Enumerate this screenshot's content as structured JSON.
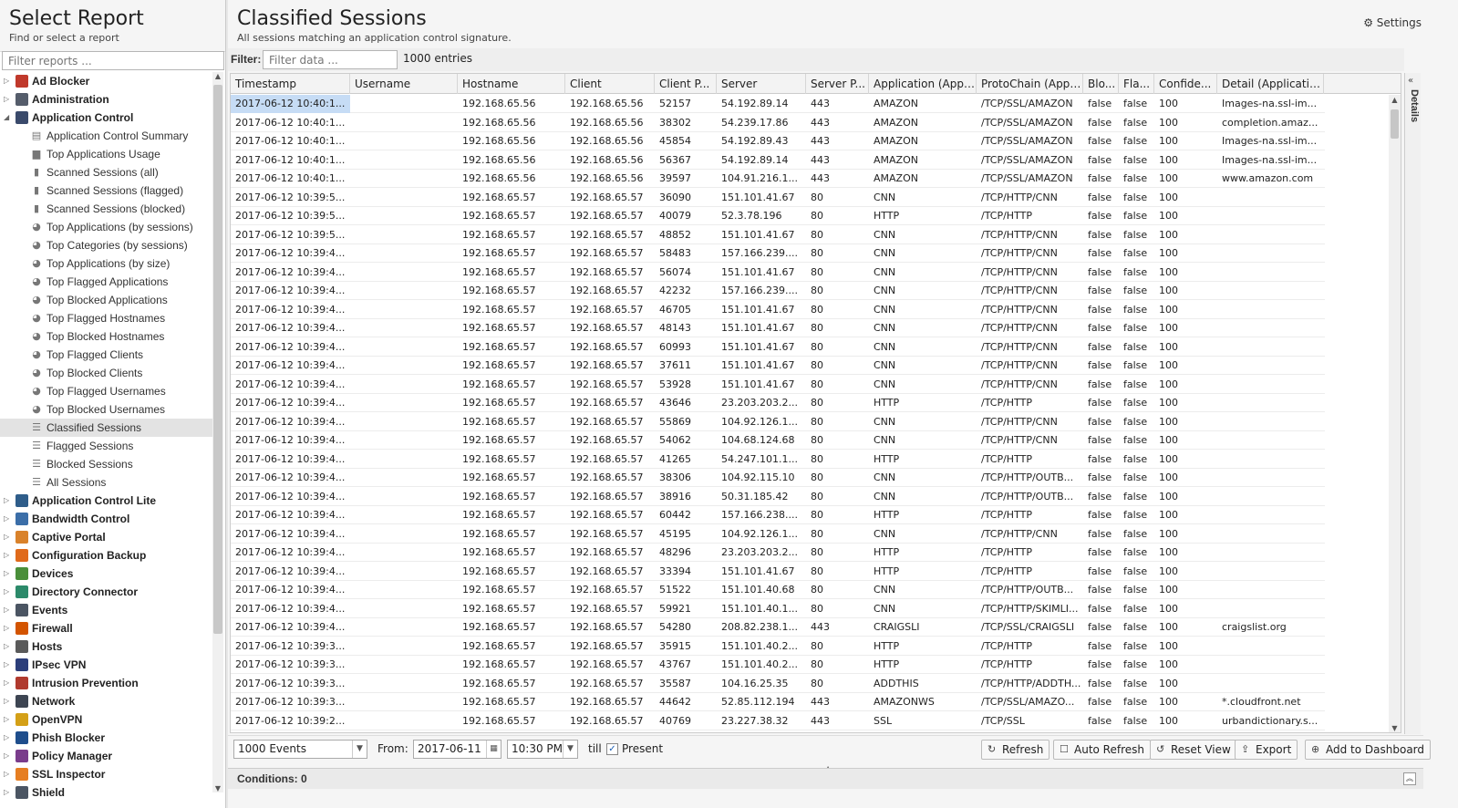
{
  "left": {
    "title": "Select Report",
    "subtitle": "Find or select a report",
    "filter_placeholder": "Filter reports ..."
  },
  "tree": [
    {
      "label": "Ad Blocker",
      "type": "app",
      "color": "#c0392b",
      "expanded": false
    },
    {
      "label": "Administration",
      "type": "app",
      "color": "#555d6b",
      "expanded": false
    },
    {
      "label": "Application Control",
      "type": "app",
      "color": "#3a4a6b",
      "expanded": true
    },
    {
      "label": "Application Control Summary",
      "type": "child",
      "icon": "doc"
    },
    {
      "label": "Top Applications Usage",
      "type": "child",
      "icon": "area"
    },
    {
      "label": "Scanned Sessions (all)",
      "type": "child",
      "icon": "bar"
    },
    {
      "label": "Scanned Sessions (flagged)",
      "type": "child",
      "icon": "bar"
    },
    {
      "label": "Scanned Sessions (blocked)",
      "type": "child",
      "icon": "bar"
    },
    {
      "label": "Top Applications (by sessions)",
      "type": "child",
      "icon": "pie"
    },
    {
      "label": "Top Categories (by sessions)",
      "type": "child",
      "icon": "pie"
    },
    {
      "label": "Top Applications (by size)",
      "type": "child",
      "icon": "pie"
    },
    {
      "label": "Top Flagged Applications",
      "type": "child",
      "icon": "pie"
    },
    {
      "label": "Top Blocked Applications",
      "type": "child",
      "icon": "pie"
    },
    {
      "label": "Top Flagged Hostnames",
      "type": "child",
      "icon": "pie"
    },
    {
      "label": "Top Blocked Hostnames",
      "type": "child",
      "icon": "pie"
    },
    {
      "label": "Top Flagged Clients",
      "type": "child",
      "icon": "pie"
    },
    {
      "label": "Top Blocked Clients",
      "type": "child",
      "icon": "pie"
    },
    {
      "label": "Top Flagged Usernames",
      "type": "child",
      "icon": "pie"
    },
    {
      "label": "Top Blocked Usernames",
      "type": "child",
      "icon": "pie"
    },
    {
      "label": "Classified Sessions",
      "type": "child",
      "icon": "list",
      "selected": true
    },
    {
      "label": "Flagged Sessions",
      "type": "child",
      "icon": "list"
    },
    {
      "label": "Blocked Sessions",
      "type": "child",
      "icon": "list"
    },
    {
      "label": "All Sessions",
      "type": "child",
      "icon": "list"
    },
    {
      "label": "Application Control Lite",
      "type": "app",
      "color": "#2f5d8a",
      "expanded": false
    },
    {
      "label": "Bandwidth Control",
      "type": "app",
      "color": "#3b6ea8",
      "expanded": false
    },
    {
      "label": "Captive Portal",
      "type": "app",
      "color": "#d9822b",
      "expanded": false
    },
    {
      "label": "Configuration Backup",
      "type": "app",
      "color": "#e06a1b",
      "expanded": false
    },
    {
      "label": "Devices",
      "type": "app",
      "color": "#4a8f3a",
      "expanded": false
    },
    {
      "label": "Directory Connector",
      "type": "app",
      "color": "#2c8a6a",
      "expanded": false
    },
    {
      "label": "Events",
      "type": "app",
      "color": "#4b5563",
      "expanded": false
    },
    {
      "label": "Firewall",
      "type": "app",
      "color": "#d35400",
      "expanded": false
    },
    {
      "label": "Hosts",
      "type": "app",
      "color": "#5a5a5a",
      "expanded": false
    },
    {
      "label": "IPsec VPN",
      "type": "app",
      "color": "#2c3e7a",
      "expanded": false
    },
    {
      "label": "Intrusion Prevention",
      "type": "app",
      "color": "#b03a2e",
      "expanded": false
    },
    {
      "label": "Network",
      "type": "app",
      "color": "#3d4552",
      "expanded": false
    },
    {
      "label": "OpenVPN",
      "type": "app",
      "color": "#d4a017",
      "expanded": false
    },
    {
      "label": "Phish Blocker",
      "type": "app",
      "color": "#1f4e8c",
      "expanded": false
    },
    {
      "label": "Policy Manager",
      "type": "app",
      "color": "#7a3d8c",
      "expanded": false
    },
    {
      "label": "SSL Inspector",
      "type": "app",
      "color": "#e67e22",
      "expanded": false
    },
    {
      "label": "Shield",
      "type": "app",
      "color": "#4b5563",
      "expanded": false
    }
  ],
  "main": {
    "title": "Classified Sessions",
    "subtitle": "All sessions matching an application control signature.",
    "settings_label": "Settings",
    "filter_label": "Filter:",
    "filter_placeholder": "Filter data ...",
    "entries": "1000 entries",
    "details_label": "Details"
  },
  "table": {
    "columns": [
      "Timestamp",
      "Username",
      "Hostname",
      "Client",
      "Client P...",
      "Server",
      "Server P...",
      "Application (Appli...",
      "ProtoChain (Appli...",
      "Blo...",
      "Fla...",
      "Confide...",
      "Detail (Applicatio..."
    ],
    "rows": [
      [
        "2017-06-12 10:40:1...",
        "",
        "192.168.65.56",
        "192.168.65.56",
        "52157",
        "54.192.89.14",
        "443",
        "AMAZON",
        "/TCP/SSL/AMAZON",
        "false",
        "false",
        "100",
        "Images-na.ssl-im..."
      ],
      [
        "2017-06-12 10:40:1...",
        "",
        "192.168.65.56",
        "192.168.65.56",
        "38302",
        "54.239.17.86",
        "443",
        "AMAZON",
        "/TCP/SSL/AMAZON",
        "false",
        "false",
        "100",
        "completion.amaz..."
      ],
      [
        "2017-06-12 10:40:1...",
        "",
        "192.168.65.56",
        "192.168.65.56",
        "45854",
        "54.192.89.43",
        "443",
        "AMAZON",
        "/TCP/SSL/AMAZON",
        "false",
        "false",
        "100",
        "Images-na.ssl-im..."
      ],
      [
        "2017-06-12 10:40:1...",
        "",
        "192.168.65.56",
        "192.168.65.56",
        "56367",
        "54.192.89.14",
        "443",
        "AMAZON",
        "/TCP/SSL/AMAZON",
        "false",
        "false",
        "100",
        "Images-na.ssl-im..."
      ],
      [
        "2017-06-12 10:40:1...",
        "",
        "192.168.65.56",
        "192.168.65.56",
        "39597",
        "104.91.216.1...",
        "443",
        "AMAZON",
        "/TCP/SSL/AMAZON",
        "false",
        "false",
        "100",
        "www.amazon.com"
      ],
      [
        "2017-06-12 10:39:5...",
        "",
        "192.168.65.57",
        "192.168.65.57",
        "36090",
        "151.101.41.67",
        "80",
        "CNN",
        "/TCP/HTTP/CNN",
        "false",
        "false",
        "100",
        ""
      ],
      [
        "2017-06-12 10:39:5...",
        "",
        "192.168.65.57",
        "192.168.65.57",
        "40079",
        "52.3.78.196",
        "80",
        "HTTP",
        "/TCP/HTTP",
        "false",
        "false",
        "100",
        ""
      ],
      [
        "2017-06-12 10:39:5...",
        "",
        "192.168.65.57",
        "192.168.65.57",
        "48852",
        "151.101.41.67",
        "80",
        "CNN",
        "/TCP/HTTP/CNN",
        "false",
        "false",
        "100",
        ""
      ],
      [
        "2017-06-12 10:39:4...",
        "",
        "192.168.65.57",
        "192.168.65.57",
        "58483",
        "157.166.239....",
        "80",
        "CNN",
        "/TCP/HTTP/CNN",
        "false",
        "false",
        "100",
        ""
      ],
      [
        "2017-06-12 10:39:4...",
        "",
        "192.168.65.57",
        "192.168.65.57",
        "56074",
        "151.101.41.67",
        "80",
        "CNN",
        "/TCP/HTTP/CNN",
        "false",
        "false",
        "100",
        ""
      ],
      [
        "2017-06-12 10:39:4...",
        "",
        "192.168.65.57",
        "192.168.65.57",
        "42232",
        "157.166.239....",
        "80",
        "CNN",
        "/TCP/HTTP/CNN",
        "false",
        "false",
        "100",
        ""
      ],
      [
        "2017-06-12 10:39:4...",
        "",
        "192.168.65.57",
        "192.168.65.57",
        "46705",
        "151.101.41.67",
        "80",
        "CNN",
        "/TCP/HTTP/CNN",
        "false",
        "false",
        "100",
        ""
      ],
      [
        "2017-06-12 10:39:4...",
        "",
        "192.168.65.57",
        "192.168.65.57",
        "48143",
        "151.101.41.67",
        "80",
        "CNN",
        "/TCP/HTTP/CNN",
        "false",
        "false",
        "100",
        ""
      ],
      [
        "2017-06-12 10:39:4...",
        "",
        "192.168.65.57",
        "192.168.65.57",
        "60993",
        "151.101.41.67",
        "80",
        "CNN",
        "/TCP/HTTP/CNN",
        "false",
        "false",
        "100",
        ""
      ],
      [
        "2017-06-12 10:39:4...",
        "",
        "192.168.65.57",
        "192.168.65.57",
        "37611",
        "151.101.41.67",
        "80",
        "CNN",
        "/TCP/HTTP/CNN",
        "false",
        "false",
        "100",
        ""
      ],
      [
        "2017-06-12 10:39:4...",
        "",
        "192.168.65.57",
        "192.168.65.57",
        "53928",
        "151.101.41.67",
        "80",
        "CNN",
        "/TCP/HTTP/CNN",
        "false",
        "false",
        "100",
        ""
      ],
      [
        "2017-06-12 10:39:4...",
        "",
        "192.168.65.57",
        "192.168.65.57",
        "43646",
        "23.203.203.2...",
        "80",
        "HTTP",
        "/TCP/HTTP",
        "false",
        "false",
        "100",
        ""
      ],
      [
        "2017-06-12 10:39:4...",
        "",
        "192.168.65.57",
        "192.168.65.57",
        "55869",
        "104.92.126.1...",
        "80",
        "CNN",
        "/TCP/HTTP/CNN",
        "false",
        "false",
        "100",
        ""
      ],
      [
        "2017-06-12 10:39:4...",
        "",
        "192.168.65.57",
        "192.168.65.57",
        "54062",
        "104.68.124.68",
        "80",
        "CNN",
        "/TCP/HTTP/CNN",
        "false",
        "false",
        "100",
        ""
      ],
      [
        "2017-06-12 10:39:4...",
        "",
        "192.168.65.57",
        "192.168.65.57",
        "41265",
        "54.247.101.1...",
        "80",
        "HTTP",
        "/TCP/HTTP",
        "false",
        "false",
        "100",
        ""
      ],
      [
        "2017-06-12 10:39:4...",
        "",
        "192.168.65.57",
        "192.168.65.57",
        "38306",
        "104.92.115.10",
        "80",
        "CNN",
        "/TCP/HTTP/OUTB...",
        "false",
        "false",
        "100",
        ""
      ],
      [
        "2017-06-12 10:39:4...",
        "",
        "192.168.65.57",
        "192.168.65.57",
        "38916",
        "50.31.185.42",
        "80",
        "CNN",
        "/TCP/HTTP/OUTB...",
        "false",
        "false",
        "100",
        ""
      ],
      [
        "2017-06-12 10:39:4...",
        "",
        "192.168.65.57",
        "192.168.65.57",
        "60442",
        "157.166.238....",
        "80",
        "HTTP",
        "/TCP/HTTP",
        "false",
        "false",
        "100",
        ""
      ],
      [
        "2017-06-12 10:39:4...",
        "",
        "192.168.65.57",
        "192.168.65.57",
        "45195",
        "104.92.126.1...",
        "80",
        "CNN",
        "/TCP/HTTP/CNN",
        "false",
        "false",
        "100",
        ""
      ],
      [
        "2017-06-12 10:39:4...",
        "",
        "192.168.65.57",
        "192.168.65.57",
        "48296",
        "23.203.203.2...",
        "80",
        "HTTP",
        "/TCP/HTTP",
        "false",
        "false",
        "100",
        ""
      ],
      [
        "2017-06-12 10:39:4...",
        "",
        "192.168.65.57",
        "192.168.65.57",
        "33394",
        "151.101.41.67",
        "80",
        "HTTP",
        "/TCP/HTTP",
        "false",
        "false",
        "100",
        ""
      ],
      [
        "2017-06-12 10:39:4...",
        "",
        "192.168.65.57",
        "192.168.65.57",
        "51522",
        "151.101.40.68",
        "80",
        "CNN",
        "/TCP/HTTP/OUTB...",
        "false",
        "false",
        "100",
        ""
      ],
      [
        "2017-06-12 10:39:4...",
        "",
        "192.168.65.57",
        "192.168.65.57",
        "59921",
        "151.101.40.1...",
        "80",
        "CNN",
        "/TCP/HTTP/SKIMLI...",
        "false",
        "false",
        "100",
        ""
      ],
      [
        "2017-06-12 10:39:4...",
        "",
        "192.168.65.57",
        "192.168.65.57",
        "54280",
        "208.82.238.1...",
        "443",
        "CRAIGSLI",
        "/TCP/SSL/CRAIGSLI",
        "false",
        "false",
        "100",
        "craigslist.org"
      ],
      [
        "2017-06-12 10:39:3...",
        "",
        "192.168.65.57",
        "192.168.65.57",
        "35915",
        "151.101.40.2...",
        "80",
        "HTTP",
        "/TCP/HTTP",
        "false",
        "false",
        "100",
        ""
      ],
      [
        "2017-06-12 10:39:3...",
        "",
        "192.168.65.57",
        "192.168.65.57",
        "43767",
        "151.101.40.2...",
        "80",
        "HTTP",
        "/TCP/HTTP",
        "false",
        "false",
        "100",
        ""
      ],
      [
        "2017-06-12 10:39:3...",
        "",
        "192.168.65.57",
        "192.168.65.57",
        "35587",
        "104.16.25.35",
        "80",
        "ADDTHIS",
        "/TCP/HTTP/ADDTH...",
        "false",
        "false",
        "100",
        ""
      ],
      [
        "2017-06-12 10:39:3...",
        "",
        "192.168.65.57",
        "192.168.65.57",
        "44642",
        "52.85.112.194",
        "443",
        "AMAZONWS",
        "/TCP/SSL/AMAZO...",
        "false",
        "false",
        "100",
        "*.cloudfront.net"
      ],
      [
        "2017-06-12 10:39:2...",
        "",
        "192.168.65.57",
        "192.168.65.57",
        "40769",
        "23.227.38.32",
        "443",
        "SSL",
        "/TCP/SSL",
        "false",
        "false",
        "100",
        "urbandictionary.s..."
      ]
    ]
  },
  "toolbar": {
    "events_select": "1000 Events",
    "from_label": "From:",
    "from_date": "2017-06-11",
    "from_time": "10:30 PM",
    "till_label": "till",
    "present_label": "Present",
    "refresh": "Refresh",
    "auto_refresh": "Auto Refresh",
    "reset_view": "Reset View",
    "export": "Export",
    "add_dashboard": "Add to Dashboard"
  },
  "conditions": {
    "label": "Conditions: 0"
  }
}
